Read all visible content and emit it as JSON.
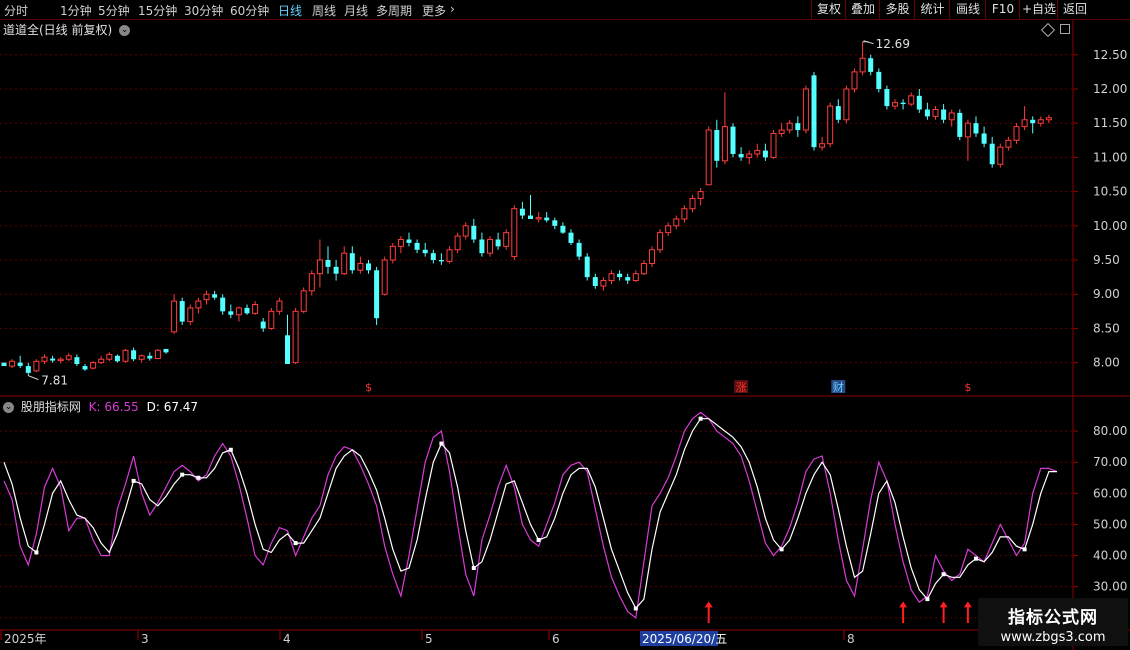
{
  "toolbar": {
    "timeframes": [
      "分时",
      "1分钟",
      "5分钟",
      "15分钟",
      "30分钟",
      "60分钟",
      "日线",
      "周线",
      "月线",
      "多周期",
      "更多"
    ],
    "active": "日线",
    "more_chevron": "›",
    "right_buttons": [
      "复权",
      "叠加",
      "多股",
      "统计",
      "画线",
      "F10",
      "+自选",
      "返回"
    ]
  },
  "price_chart": {
    "title": "道道全(日线 前复权)",
    "high_label": "12.69",
    "low_label": "7.81",
    "y_ticks": [
      "12.50",
      "12.00",
      "11.50",
      "11.00",
      "10.50",
      "10.00",
      "9.50",
      "9.00",
      "8.50",
      "8.00"
    ],
    "markers": [
      {
        "label": "$",
        "color": "#ff3030"
      },
      {
        "label": "涨",
        "color": "#ff3030"
      },
      {
        "label": "财",
        "color": "#5fd4ff"
      },
      {
        "label": "$",
        "color": "#ff3030"
      }
    ],
    "colors": {
      "up": "#ff3c3c",
      "down": "#54ffff"
    }
  },
  "indicator": {
    "name": "股朋指标网",
    "k_label": "K: 66.55",
    "d_label": "D: 67.47",
    "k_color": "#d63cd6",
    "d_color": "#ffffff",
    "y_ticks": [
      "80.00",
      "70.00",
      "60.00",
      "50.00",
      "40.00",
      "30.00"
    ]
  },
  "date_axis": {
    "labels": [
      "2025年",
      "3",
      "4",
      "5",
      "6",
      "8"
    ],
    "highlight": "2025/06/20/五"
  },
  "watermark": {
    "title": "指标公式网",
    "url": "www.zbgs3.com"
  },
  "chart_data": [
    {
      "type": "candlestick",
      "title": "道道全(日线 前复权)",
      "ylim": [
        7.6,
        12.95
      ],
      "ohlc": [
        [
          8.0,
          8.0,
          7.95,
          7.95
        ],
        [
          7.95,
          8.05,
          7.92,
          8.02
        ],
        [
          8.0,
          8.1,
          7.92,
          7.95
        ],
        [
          7.95,
          8.0,
          7.81,
          7.85
        ],
        [
          7.88,
          8.05,
          7.86,
          8.02
        ],
        [
          8.02,
          8.12,
          7.98,
          8.08
        ],
        [
          8.06,
          8.1,
          8.0,
          8.03
        ],
        [
          8.03,
          8.08,
          7.99,
          8.05
        ],
        [
          8.05,
          8.14,
          8.02,
          8.1
        ],
        [
          8.08,
          8.12,
          7.95,
          7.98
        ],
        [
          7.95,
          7.98,
          7.88,
          7.9
        ],
        [
          7.92,
          8.02,
          7.9,
          8.0
        ],
        [
          8.0,
          8.1,
          7.98,
          8.05
        ],
        [
          8.05,
          8.15,
          8.02,
          8.12
        ],
        [
          8.1,
          8.12,
          8.0,
          8.02
        ],
        [
          8.02,
          8.2,
          8.0,
          8.18
        ],
        [
          8.18,
          8.22,
          8.02,
          8.05
        ],
        [
          8.05,
          8.12,
          8.0,
          8.1
        ],
        [
          8.1,
          8.15,
          8.03,
          8.06
        ],
        [
          8.06,
          8.2,
          8.05,
          8.18
        ],
        [
          8.2,
          8.2,
          8.13,
          8.15
        ],
        [
          8.45,
          9.0,
          8.42,
          8.9
        ],
        [
          8.9,
          8.95,
          8.55,
          8.6
        ],
        [
          8.6,
          8.85,
          8.55,
          8.8
        ],
        [
          8.8,
          8.95,
          8.72,
          8.9
        ],
        [
          8.92,
          9.05,
          8.85,
          9.0
        ],
        [
          9.0,
          9.05,
          8.92,
          8.95
        ],
        [
          8.95,
          9.0,
          8.7,
          8.75
        ],
        [
          8.75,
          8.85,
          8.65,
          8.7
        ],
        [
          8.7,
          8.82,
          8.6,
          8.8
        ],
        [
          8.8,
          8.85,
          8.7,
          8.72
        ],
        [
          8.72,
          8.9,
          8.7,
          8.85
        ],
        [
          8.6,
          8.65,
          8.45,
          8.5
        ],
        [
          8.5,
          8.8,
          8.48,
          8.75
        ],
        [
          8.75,
          8.95,
          8.7,
          8.9
        ],
        [
          8.4,
          8.7,
          7.98,
          7.98
        ],
        [
          8.0,
          8.8,
          7.98,
          8.75
        ],
        [
          8.75,
          9.1,
          8.72,
          9.05
        ],
        [
          9.05,
          9.35,
          8.98,
          9.3
        ],
        [
          9.3,
          9.8,
          9.1,
          9.5
        ],
        [
          9.5,
          9.7,
          9.3,
          9.4
        ],
        [
          9.4,
          9.5,
          9.2,
          9.3
        ],
        [
          9.3,
          9.7,
          9.28,
          9.6
        ],
        [
          9.6,
          9.7,
          9.3,
          9.35
        ],
        [
          9.35,
          9.55,
          9.3,
          9.45
        ],
        [
          9.45,
          9.5,
          9.3,
          9.35
        ],
        [
          9.35,
          9.4,
          8.55,
          8.65
        ],
        [
          9.0,
          9.55,
          8.98,
          9.5
        ],
        [
          9.5,
          9.75,
          9.45,
          9.7
        ],
        [
          9.7,
          9.85,
          9.6,
          9.8
        ],
        [
          9.8,
          9.9,
          9.7,
          9.75
        ],
        [
          9.75,
          9.8,
          9.6,
          9.65
        ],
        [
          9.65,
          9.75,
          9.55,
          9.6
        ],
        [
          9.6,
          9.65,
          9.45,
          9.5
        ],
        [
          9.5,
          9.6,
          9.43,
          9.48
        ],
        [
          9.48,
          9.7,
          9.45,
          9.65
        ],
        [
          9.65,
          9.9,
          9.6,
          9.85
        ],
        [
          9.85,
          10.05,
          9.8,
          10.0
        ],
        [
          10.0,
          10.1,
          9.75,
          9.8
        ],
        [
          9.8,
          9.9,
          9.55,
          9.6
        ],
        [
          9.6,
          9.85,
          9.55,
          9.8
        ],
        [
          9.8,
          9.9,
          9.65,
          9.7
        ],
        [
          9.7,
          9.95,
          9.65,
          9.9
        ],
        [
          9.55,
          10.3,
          9.5,
          10.25
        ],
        [
          10.25,
          10.35,
          10.1,
          10.15
        ],
        [
          10.15,
          10.45,
          10.1,
          10.1
        ],
        [
          10.1,
          10.2,
          10.05,
          10.12
        ],
        [
          10.12,
          10.2,
          10.05,
          10.08
        ],
        [
          10.08,
          10.12,
          9.95,
          10.0
        ],
        [
          10.0,
          10.05,
          9.88,
          9.9
        ],
        [
          9.9,
          9.95,
          9.72,
          9.75
        ],
        [
          9.75,
          9.8,
          9.5,
          9.55
        ],
        [
          9.55,
          9.6,
          9.2,
          9.25
        ],
        [
          9.25,
          9.3,
          9.08,
          9.12
        ],
        [
          9.12,
          9.25,
          9.05,
          9.2
        ],
        [
          9.2,
          9.35,
          9.15,
          9.3
        ],
        [
          9.3,
          9.35,
          9.2,
          9.25
        ],
        [
          9.25,
          9.3,
          9.15,
          9.2
        ],
        [
          9.2,
          9.35,
          9.18,
          9.3
        ],
        [
          9.3,
          9.5,
          9.28,
          9.45
        ],
        [
          9.45,
          9.7,
          9.4,
          9.65
        ],
        [
          9.65,
          9.95,
          9.6,
          9.9
        ],
        [
          9.9,
          10.05,
          9.85,
          10.0
        ],
        [
          10.0,
          10.15,
          9.95,
          10.1
        ],
        [
          10.1,
          10.3,
          10.05,
          10.25
        ],
        [
          10.25,
          10.45,
          10.2,
          10.4
        ],
        [
          10.4,
          10.55,
          10.3,
          10.5
        ],
        [
          10.6,
          11.45,
          10.6,
          11.4
        ],
        [
          11.4,
          11.55,
          10.85,
          10.95
        ],
        [
          10.95,
          11.95,
          10.9,
          11.45
        ],
        [
          11.45,
          11.5,
          11.0,
          11.05
        ],
        [
          11.05,
          11.15,
          10.95,
          11.0
        ],
        [
          11.0,
          11.1,
          10.9,
          11.05
        ],
        [
          11.05,
          11.2,
          11.0,
          11.1
        ],
        [
          11.1,
          11.2,
          10.95,
          11.0
        ],
        [
          11.0,
          11.4,
          10.98,
          11.35
        ],
        [
          11.35,
          11.5,
          11.3,
          11.4
        ],
        [
          11.4,
          11.55,
          11.35,
          11.5
        ],
        [
          11.5,
          11.6,
          11.3,
          11.4
        ],
        [
          11.4,
          12.05,
          11.35,
          12.0
        ],
        [
          12.2,
          12.25,
          11.1,
          11.15
        ],
        [
          11.15,
          11.3,
          11.1,
          11.2
        ],
        [
          11.2,
          11.8,
          11.15,
          11.75
        ],
        [
          11.75,
          11.85,
          11.5,
          11.55
        ],
        [
          11.55,
          12.05,
          11.5,
          12.0
        ],
        [
          12.0,
          12.3,
          11.95,
          12.25
        ],
        [
          12.25,
          12.69,
          12.2,
          12.45
        ],
        [
          12.45,
          12.5,
          12.2,
          12.25
        ],
        [
          12.25,
          12.3,
          11.95,
          12.0
        ],
        [
          12.0,
          12.05,
          11.7,
          11.75
        ],
        [
          11.75,
          11.85,
          11.7,
          11.8
        ],
        [
          11.8,
          11.85,
          11.7,
          11.78
        ],
        [
          11.78,
          11.95,
          11.75,
          11.9
        ],
        [
          11.9,
          12.0,
          11.65,
          11.7
        ],
        [
          11.7,
          11.8,
          11.55,
          11.6
        ],
        [
          11.6,
          11.75,
          11.55,
          11.7
        ],
        [
          11.7,
          11.78,
          11.5,
          11.55
        ],
        [
          11.55,
          11.7,
          11.45,
          11.65
        ],
        [
          11.65,
          11.7,
          11.25,
          11.3
        ],
        [
          11.3,
          11.55,
          10.95,
          11.5
        ],
        [
          11.5,
          11.6,
          11.3,
          11.35
        ],
        [
          11.35,
          11.45,
          11.15,
          11.2
        ],
        [
          11.2,
          11.3,
          10.85,
          10.9
        ],
        [
          10.9,
          11.2,
          10.85,
          11.15
        ],
        [
          11.15,
          11.3,
          11.1,
          11.25
        ],
        [
          11.25,
          11.5,
          11.2,
          11.45
        ],
        [
          11.45,
          11.75,
          11.4,
          11.55
        ],
        [
          11.55,
          11.6,
          11.35,
          11.5
        ],
        [
          11.5,
          11.6,
          11.45,
          11.55
        ],
        [
          11.55,
          11.62,
          11.5,
          11.58
        ]
      ]
    },
    {
      "type": "line",
      "title": "股朋指标网",
      "ylim": [
        18,
        90
      ],
      "series": [
        {
          "name": "K",
          "values": [
            64,
            58,
            43,
            37,
            47,
            62,
            68,
            62,
            48,
            52,
            52,
            45,
            40,
            40,
            55,
            63,
            72,
            60,
            53,
            57,
            62,
            67,
            69,
            67,
            64,
            66,
            72,
            76,
            72,
            63,
            52,
            40,
            37,
            44,
            49,
            48,
            40,
            46,
            52,
            56,
            66,
            72,
            75,
            74,
            69,
            63,
            56,
            43,
            34,
            27,
            40,
            55,
            70,
            78,
            80,
            67,
            50,
            34,
            27,
            45,
            53,
            62,
            69,
            62,
            50,
            45,
            43,
            50,
            57,
            66,
            69,
            70,
            67,
            55,
            43,
            33,
            27,
            22,
            20,
            38,
            56,
            60,
            65,
            72,
            80,
            84,
            86,
            84,
            80,
            78,
            76,
            72,
            64,
            54,
            44,
            40,
            43,
            49,
            57,
            67,
            71,
            72,
            60,
            45,
            32,
            27,
            42,
            58,
            70,
            64,
            50,
            38,
            29,
            25,
            27,
            40,
            35,
            32,
            34,
            42,
            40,
            38,
            44,
            50,
            45,
            40,
            44,
            60,
            68,
            68,
            67
          ]
        },
        {
          "name": "D",
          "values": [
            70,
            63,
            52,
            43,
            41,
            50,
            60,
            64,
            58,
            53,
            52,
            49,
            44,
            41,
            47,
            55,
            64,
            63,
            58,
            56,
            59,
            63,
            66,
            66,
            65,
            65,
            68,
            73,
            74,
            68,
            60,
            50,
            42,
            41,
            45,
            47,
            44,
            44,
            48,
            52,
            60,
            68,
            72,
            74,
            72,
            67,
            61,
            52,
            42,
            35,
            36,
            45,
            58,
            70,
            76,
            73,
            62,
            48,
            36,
            38,
            45,
            54,
            63,
            64,
            57,
            50,
            45,
            46,
            52,
            60,
            66,
            68,
            68,
            62,
            52,
            42,
            35,
            28,
            23,
            26,
            42,
            54,
            60,
            66,
            74,
            80,
            84,
            84,
            82,
            80,
            78,
            75,
            70,
            62,
            52,
            45,
            42,
            45,
            52,
            60,
            66,
            70,
            66,
            55,
            43,
            33,
            35,
            47,
            60,
            64,
            57,
            46,
            36,
            29,
            26,
            31,
            34,
            33,
            33,
            37,
            39,
            38,
            41,
            46,
            46,
            43,
            42,
            50,
            60,
            67,
            67
          ]
        }
      ],
      "up_arrows": [
        87,
        111,
        116,
        119,
        121
      ]
    }
  ]
}
